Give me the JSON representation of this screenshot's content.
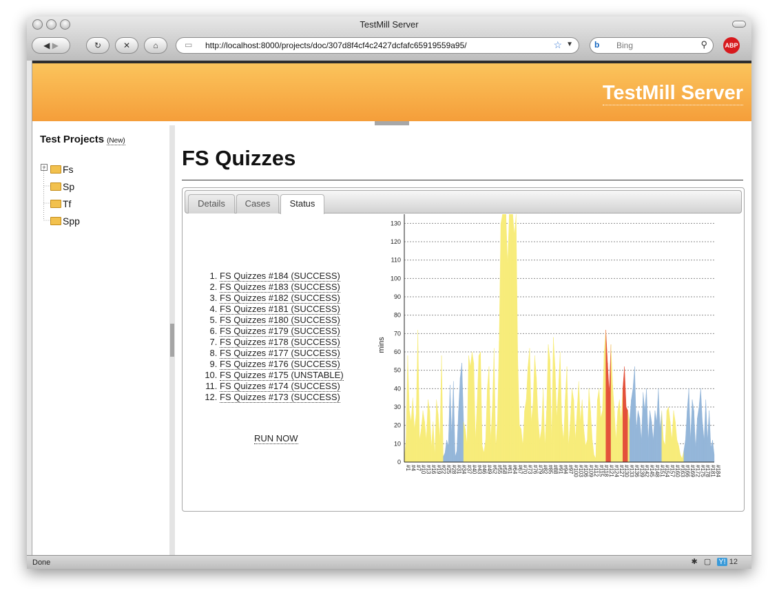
{
  "browser": {
    "window_title": "TestMill Server",
    "url": "http://localhost:8000/projects/doc/307d8f4cf4c2427dcfafc65919559a95/",
    "search_placeholder": "Bing",
    "abp_label": "ABP",
    "status_text": "Done",
    "status_count": "12"
  },
  "header": {
    "brand": "TestMill Server"
  },
  "sidebar": {
    "title": "Test Projects",
    "new_link": "(New)",
    "projects": [
      "Fs",
      "Sp",
      "Tf",
      "Spp"
    ]
  },
  "main": {
    "title": "FS Quizzes",
    "tabs": [
      "Details",
      "Cases",
      "Status"
    ],
    "active_tab": "Status",
    "builds": [
      "FS Quizzes #184 (SUCCESS)",
      "FS Quizzes #183 (SUCCESS)",
      "FS Quizzes #182 (SUCCESS)",
      "FS Quizzes #181 (SUCCESS)",
      "FS Quizzes #180 (SUCCESS)",
      "FS Quizzes #179 (SUCCESS)",
      "FS Quizzes #178 (SUCCESS)",
      "FS Quizzes #177 (SUCCESS)",
      "FS Quizzes #176 (SUCCESS)",
      "FS Quizzes #175 (UNSTABLE)",
      "FS Quizzes #174 (SUCCESS)",
      "FS Quizzes #173 (SUCCESS)"
    ],
    "run_now": "RUN NOW"
  },
  "chart_data": {
    "type": "area",
    "ylabel": "mins",
    "ylim": [
      0,
      135
    ],
    "yticks": [
      0,
      10,
      20,
      30,
      40,
      50,
      60,
      70,
      80,
      90,
      100,
      110,
      120,
      130
    ],
    "grid": "dashed horizontal",
    "colors": {
      "success": "#f7ec7a",
      "unstable": "#94b6d9",
      "failure": "#e3503a"
    },
    "series": [
      {
        "x_range": [
          1,
          184
        ],
        "values": [
          2,
          12,
          58,
          28,
          22,
          35,
          18,
          26,
          72,
          12,
          18,
          28,
          22,
          12,
          34,
          28,
          8,
          22,
          4,
          34,
          26,
          12,
          58,
          3,
          5,
          12,
          9,
          42,
          15,
          44,
          3,
          6,
          28,
          46,
          54,
          22,
          18,
          10,
          58,
          52,
          60,
          54,
          12,
          32,
          58,
          60,
          9,
          5,
          12,
          40,
          52,
          12,
          30,
          62,
          8,
          22,
          66,
          130,
          135,
          135,
          135,
          108,
          135,
          135,
          136,
          124,
          135,
          56,
          20,
          18,
          9,
          28,
          34,
          52,
          62,
          22,
          32,
          58,
          46,
          24,
          12,
          18,
          40,
          9,
          28,
          64,
          56,
          12,
          68,
          52,
          24,
          40,
          60,
          22,
          12,
          34,
          52,
          9,
          22,
          40,
          34,
          12,
          28,
          44,
          22,
          34,
          18,
          9,
          12,
          40,
          28,
          12,
          4,
          2,
          34,
          40,
          24,
          28,
          60,
          72,
          54,
          38,
          64,
          42,
          28,
          12,
          28,
          34,
          22,
          40,
          52,
          30,
          28,
          22,
          34,
          40,
          52,
          18,
          28,
          24,
          12,
          38,
          28,
          40,
          12,
          28,
          22,
          12,
          28,
          22,
          40,
          18,
          28,
          12,
          9,
          28,
          30,
          22,
          12,
          28,
          22,
          12,
          9,
          4,
          2,
          6,
          12,
          28,
          40,
          12,
          34,
          28,
          8,
          24,
          30,
          40,
          22,
          12,
          34,
          12,
          28,
          8,
          12,
          4
        ]
      }
    ]
  }
}
